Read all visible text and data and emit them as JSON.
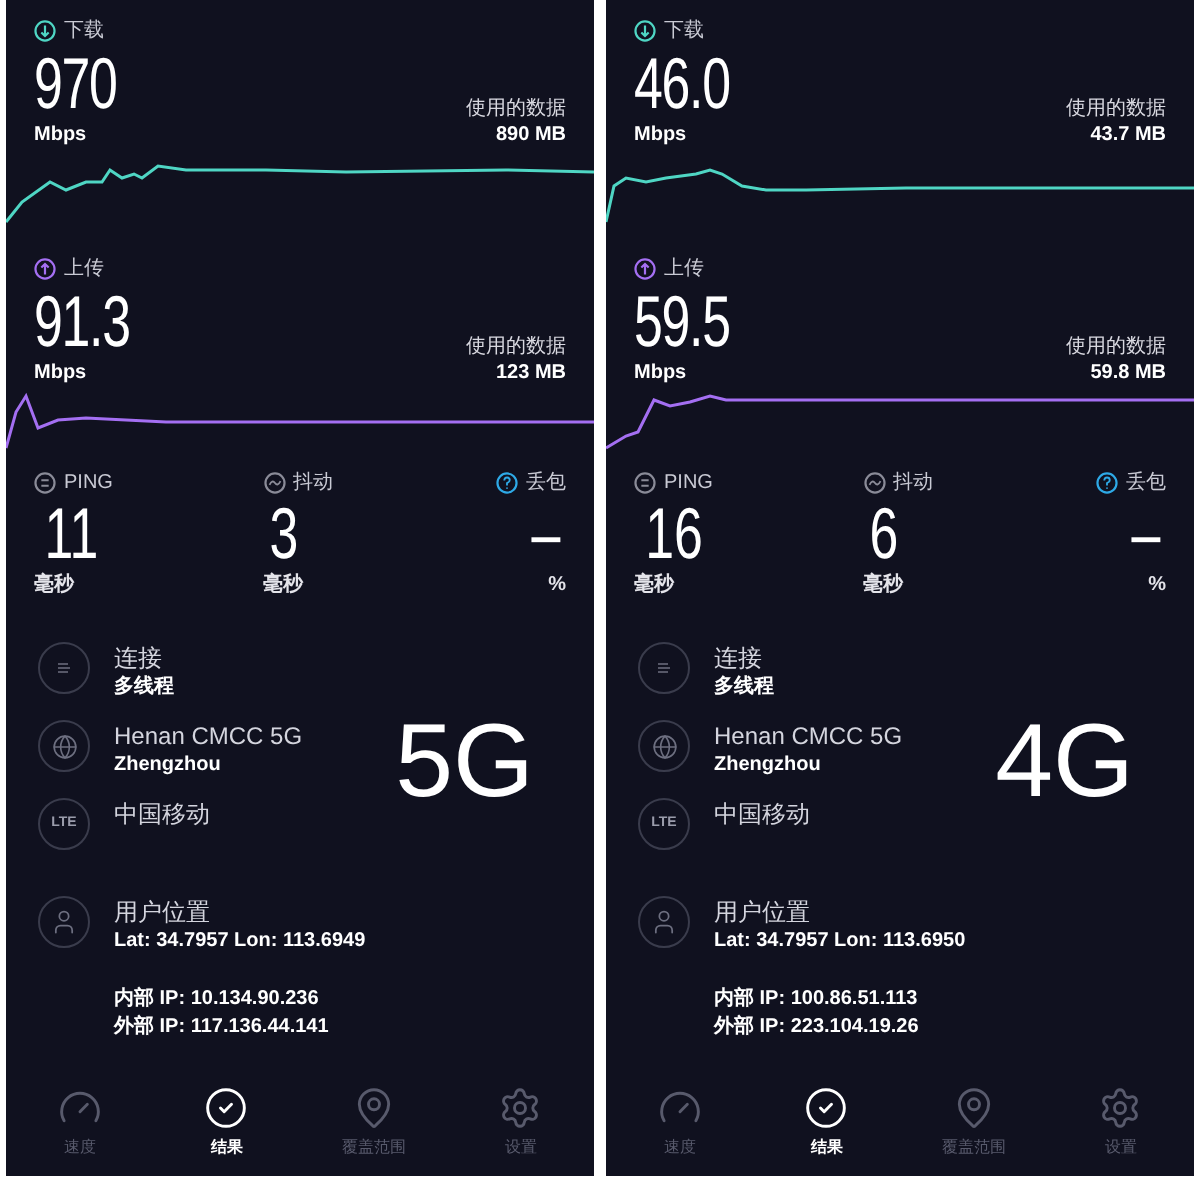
{
  "panels": [
    {
      "download": {
        "label": "下载",
        "value": "970",
        "unit": "Mbps",
        "data_label": "使用的数据",
        "data_value": "890 MB"
      },
      "upload": {
        "label": "上传",
        "value": "91.3",
        "unit": "Mbps",
        "data_label": "使用的数据",
        "data_value": "123 MB"
      },
      "stats": [
        {
          "kind": "ping",
          "label": "PING",
          "value": "11",
          "unit": "毫秒"
        },
        {
          "kind": "jitter",
          "label": "抖动",
          "value": "3",
          "unit": "毫秒"
        },
        {
          "kind": "loss",
          "label": "丢包",
          "value": "–",
          "unit": "%"
        }
      ],
      "info": [
        {
          "kind": "connection",
          "title": "连接",
          "detail": "多线程"
        },
        {
          "kind": "server",
          "title": "Henan CMCC 5G",
          "detail": "Zhengzhou"
        },
        {
          "kind": "carrier",
          "badge": "LTE",
          "title": "中国移动"
        },
        {
          "kind": "location",
          "title": "用户位置",
          "detail": "Lat: 34.7957 Lon: 113.6949"
        }
      ],
      "ip": [
        "内部 IP: 10.134.90.236",
        "外部 IP: 117.136.44.141"
      ],
      "network_label": "5G",
      "nav": [
        {
          "label": "速度",
          "selected": false
        },
        {
          "label": "结果",
          "selected": true
        },
        {
          "label": "覆盖范围",
          "selected": false
        },
        {
          "label": "设置",
          "selected": false
        }
      ]
    },
    {
      "download": {
        "label": "下载",
        "value": "46.0",
        "unit": "Mbps",
        "data_label": "使用的数据",
        "data_value": "43.7 MB"
      },
      "upload": {
        "label": "上传",
        "value": "59.5",
        "unit": "Mbps",
        "data_label": "使用的数据",
        "data_value": "59.8 MB"
      },
      "stats": [
        {
          "kind": "ping",
          "label": "PING",
          "value": "16",
          "unit": "毫秒"
        },
        {
          "kind": "jitter",
          "label": "抖动",
          "value": "6",
          "unit": "毫秒"
        },
        {
          "kind": "loss",
          "label": "丢包",
          "value": "–",
          "unit": "%"
        }
      ],
      "info": [
        {
          "kind": "connection",
          "title": "连接",
          "detail": "多线程"
        },
        {
          "kind": "server",
          "title": "Henan CMCC 5G",
          "detail": "Zhengzhou"
        },
        {
          "kind": "carrier",
          "badge": "LTE",
          "title": "中国移动"
        },
        {
          "kind": "location",
          "title": "用户位置",
          "detail": "Lat: 34.7957 Lon: 113.6950"
        }
      ],
      "ip": [
        "内部 IP: 100.86.51.113",
        "外部 IP: 223.104.19.26"
      ],
      "network_label": "4G",
      "nav": [
        {
          "label": "速度",
          "selected": false
        },
        {
          "label": "结果",
          "selected": true
        },
        {
          "label": "覆盖范围",
          "selected": false
        },
        {
          "label": "设置",
          "selected": false
        }
      ]
    }
  ]
}
